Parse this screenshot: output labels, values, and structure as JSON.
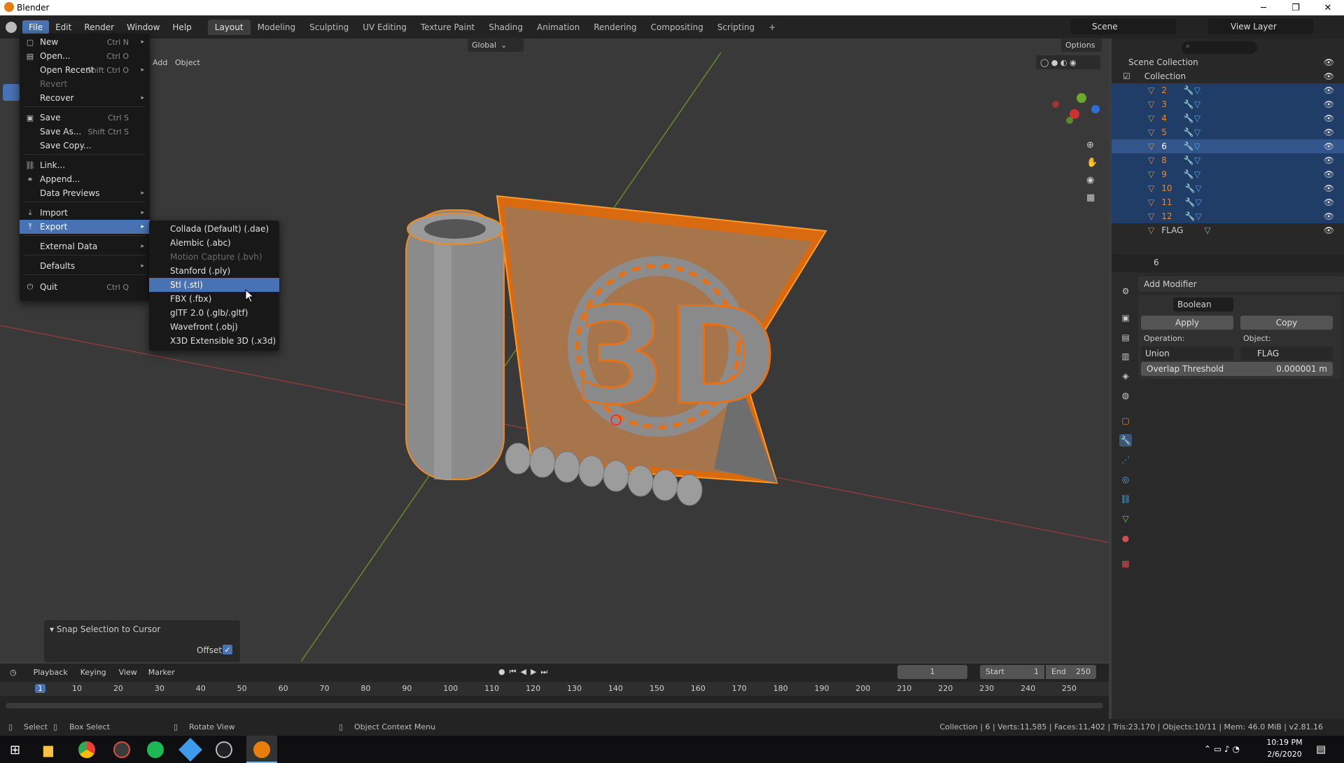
{
  "window": {
    "title": "Blender"
  },
  "topmenu": [
    "File",
    "Edit",
    "Render",
    "Window",
    "Help"
  ],
  "workspaces": [
    "Layout",
    "Modeling",
    "Sculpting",
    "UV Editing",
    "Texture Paint",
    "Shading",
    "Animation",
    "Rendering",
    "Compositing",
    "Scripting",
    "+"
  ],
  "scene": {
    "name": "Scene",
    "view_layer": "View Layer"
  },
  "viewport_header": {
    "orientation": "Global",
    "options": "Options",
    "add": "Add",
    "object": "Object"
  },
  "file_menu": [
    {
      "label": "New",
      "shortcut": "Ctrl N",
      "arrow": "▸",
      "icon": "▢"
    },
    {
      "label": "Open...",
      "shortcut": "Ctrl O",
      "icon": "▤"
    },
    {
      "label": "Open Recent",
      "shortcut": "Shift Ctrl O",
      "arrow": "▸"
    },
    {
      "label": "Revert"
    },
    {
      "label": "Recover",
      "arrow": "▸"
    },
    {
      "label": "Save",
      "shortcut": "Ctrl S",
      "icon": "▣"
    },
    {
      "label": "Save As...",
      "shortcut": "Shift Ctrl S"
    },
    {
      "label": "Save Copy..."
    },
    {
      "label": "Link...",
      "icon": "⛓"
    },
    {
      "label": "Append...",
      "icon": "⚭"
    },
    {
      "label": "Data Previews",
      "arrow": "▸"
    },
    {
      "label": "Import",
      "arrow": "▸",
      "icon": "⤓"
    },
    {
      "label": "Export",
      "arrow": "▸",
      "icon": "⤒"
    },
    {
      "label": "External Data",
      "arrow": "▸"
    },
    {
      "label": "Defaults",
      "arrow": "▸"
    },
    {
      "label": "Quit",
      "shortcut": "Ctrl Q",
      "icon": "⏻"
    }
  ],
  "export_menu": [
    "Collada (Default) (.dae)",
    "Alembic (.abc)",
    "Motion Capture (.bvh)",
    "Stanford (.ply)",
    "Stl (.stl)",
    "FBX (.fbx)",
    "glTF 2.0 (.glb/.gltf)",
    "Wavefront (.obj)",
    "X3D Extensible 3D (.x3d)"
  ],
  "snap_panel": {
    "title": "Snap Selection to Cursor",
    "offset_label": "Offset",
    "offset_checked": true
  },
  "outliner": {
    "root": "Scene Collection",
    "collection": "Collection",
    "objects": [
      "2",
      "3",
      "4",
      "5",
      "6",
      "8",
      "9",
      "10",
      "11",
      "12",
      "FLAG"
    ],
    "active": "6"
  },
  "properties": {
    "object_name": "6",
    "add_modifier": "Add Modifier",
    "modifier_name": "Boolean",
    "apply": "Apply",
    "copy": "Copy",
    "operation_label": "Operation:",
    "object_label": "Object:",
    "operation_value": "Union",
    "object_value": "FLAG",
    "overlap_label": "Overlap Threshold",
    "overlap_value": "0.000001 m"
  },
  "timeline": {
    "menus": [
      "Playback",
      "Keying",
      "View",
      "Marker"
    ],
    "current_frame": "1",
    "start_label": "Start",
    "start": "1",
    "end_label": "End",
    "end": "250",
    "ticks": [
      "1",
      "10",
      "20",
      "30",
      "40",
      "50",
      "60",
      "70",
      "80",
      "90",
      "100",
      "110",
      "120",
      "130",
      "140",
      "150",
      "160",
      "170",
      "180",
      "190",
      "200",
      "210",
      "220",
      "230",
      "240",
      "250"
    ]
  },
  "statusbar": {
    "select": "Select",
    "box_select": "Box Select",
    "rotate": "Rotate View",
    "context": "Object Context Menu",
    "stats": "Collection | 6 | Verts:11,585 | Faces:11,402 | Tris:23,170 | Objects:10/11 | Mem: 46.0 MiB | v2.81.16"
  },
  "taskbar": {
    "time": "10:19 PM",
    "date": "2/6/2020"
  },
  "colors": {
    "accent": "#4772b3",
    "selection_orange": "#f08a1c",
    "bg": "#3d3d3d"
  }
}
